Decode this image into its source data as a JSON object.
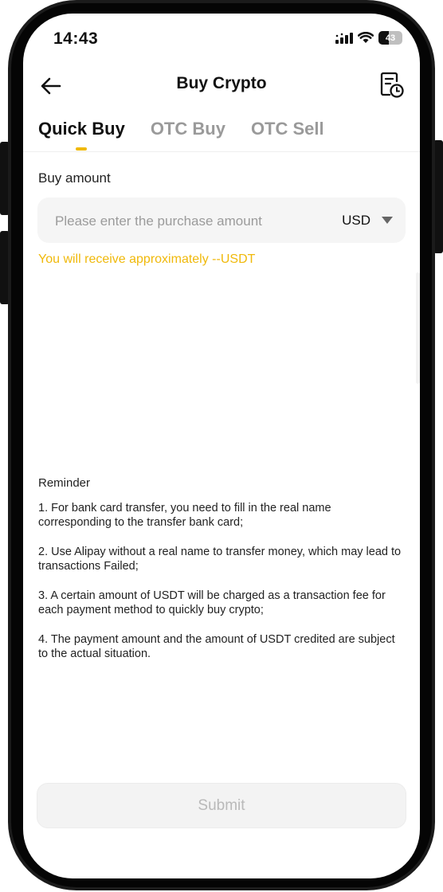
{
  "status_bar": {
    "time": "14:43",
    "battery_level": "43",
    "battery_fraction": 0.43
  },
  "header": {
    "title": "Buy Crypto",
    "back_icon": "arrow-left-icon",
    "history_icon": "order-history-icon"
  },
  "tabs": [
    {
      "label": "Quick Buy",
      "active": true
    },
    {
      "label": "OTC Buy",
      "active": false
    },
    {
      "label": "OTC Sell",
      "active": false
    }
  ],
  "form": {
    "amount_label": "Buy amount",
    "amount_placeholder": "Please enter the purchase amount",
    "amount_value": "",
    "currency": "USD",
    "receive_text": "You will receive approximately --USDT"
  },
  "reminder": {
    "title": "Reminder",
    "items": [
      "1. For bank card transfer, you need to fill in the real name corresponding to the transfer bank card;",
      "2. Use Alipay without a real name to transfer money, which may lead to transactions Failed;",
      "3. A certain amount of USDT will be charged as a transaction fee for each payment method to quickly buy crypto;",
      "4. The payment amount and the amount of USDT credited are subject to the actual situation."
    ]
  },
  "submit_label": "Submit",
  "colors": {
    "accent": "#f0b90b",
    "text": "#111111",
    "muted": "#9a9a9a",
    "input_bg": "#f5f5f5"
  }
}
